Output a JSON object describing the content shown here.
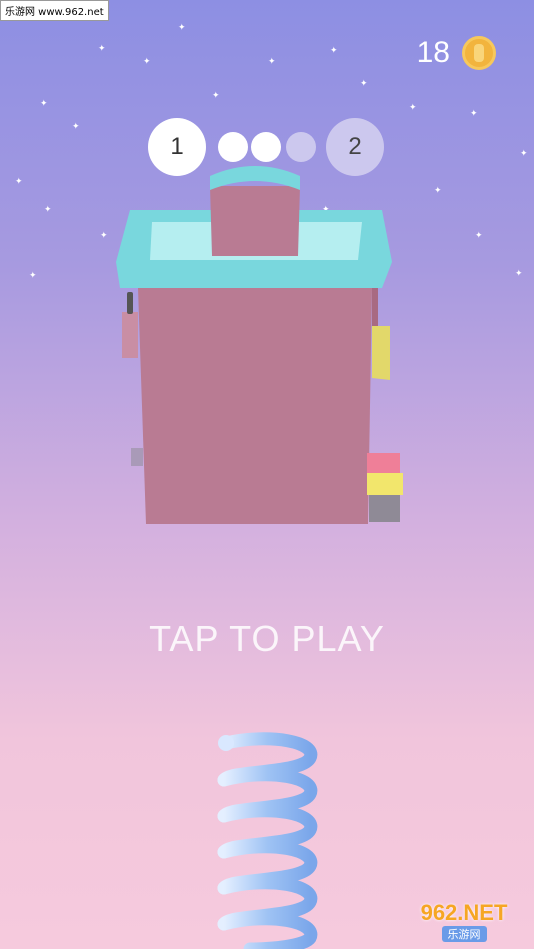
{
  "watermark_top": "乐游网 www.962.net",
  "coins": {
    "count": "18",
    "icon": "coin-icon"
  },
  "level": {
    "current": "1",
    "next": "2",
    "dots_filled": 2,
    "dots_total": 3
  },
  "prompt": "TAP TO PLAY",
  "watermark_bottom": {
    "logo": "962.NET",
    "text": "乐游网"
  },
  "colors": {
    "tower_body": "#b97b93",
    "tower_top": "#79d7dd",
    "accent_yellow": "#f2e66c",
    "accent_pink": "#ef7f98"
  }
}
